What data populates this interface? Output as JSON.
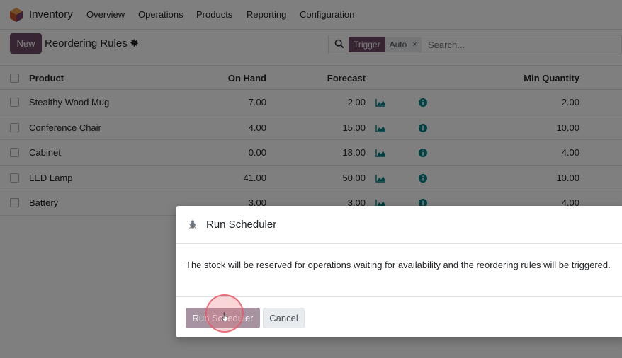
{
  "navbar": {
    "app_name": "Inventory",
    "menu": [
      "Overview",
      "Operations",
      "Products",
      "Reporting",
      "Configuration"
    ]
  },
  "control_panel": {
    "new_label": "New",
    "title": "Reordering Rules",
    "search": {
      "facet_label": "Trigger",
      "facet_value": "Auto",
      "facet_remove": "×",
      "placeholder": "Search..."
    }
  },
  "table": {
    "columns": [
      "Product",
      "On Hand",
      "Forecast",
      "Min Quantity"
    ],
    "rows": [
      {
        "product": "Stealthy Wood Mug",
        "on_hand": "7.00",
        "forecast": "2.00",
        "min_qty": "2.00"
      },
      {
        "product": "Conference Chair",
        "on_hand": "4.00",
        "forecast": "15.00",
        "min_qty": "10.00"
      },
      {
        "product": "Cabinet",
        "on_hand": "0.00",
        "forecast": "18.00",
        "min_qty": "4.00"
      },
      {
        "product": "LED Lamp",
        "on_hand": "41.00",
        "forecast": "50.00",
        "min_qty": "10.00"
      },
      {
        "product": "Battery",
        "on_hand": "3.00",
        "forecast": "3.00",
        "min_qty": "4.00"
      }
    ]
  },
  "dialog": {
    "title": "Run Scheduler",
    "body": "The stock will be reserved for operations waiting for availability and the reordering rules will be triggered.",
    "run_label": "Run Scheduler",
    "cancel_label": "Cancel"
  },
  "colors": {
    "brand": "#714b67",
    "accent_teal": "#017e84",
    "backdrop": "rgba(0,0,0,0.5)"
  },
  "icons": {
    "app": "inventory-logo-icon",
    "settings": "gear-icon",
    "search": "search-icon",
    "forecast": "area-chart-icon",
    "info": "info-icon",
    "dialog": "bug-icon"
  }
}
